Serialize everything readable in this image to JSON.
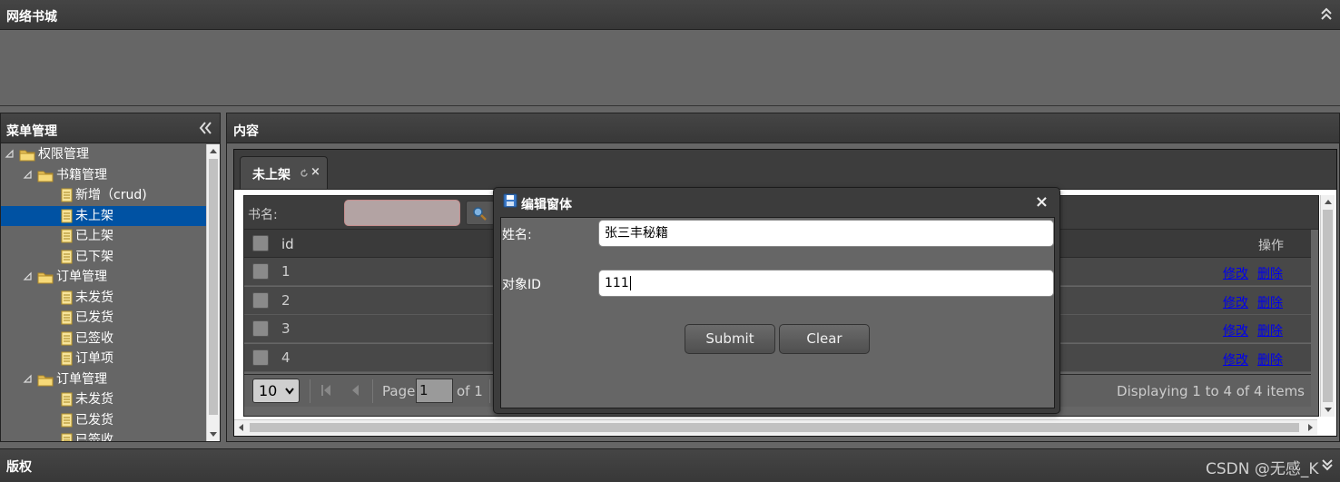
{
  "north": {
    "title": "网络书城"
  },
  "west": {
    "title": "菜单管理",
    "tree": [
      {
        "label": "权限管理",
        "type": "folder",
        "level": 0
      },
      {
        "label": "书籍管理",
        "type": "folder",
        "level": 1
      },
      {
        "label": "新增（crud)",
        "type": "file",
        "level": 2
      },
      {
        "label": "未上架",
        "type": "file",
        "level": 2,
        "selected": true
      },
      {
        "label": "已上架",
        "type": "file",
        "level": 2
      },
      {
        "label": "已下架",
        "type": "file",
        "level": 2
      },
      {
        "label": "订单管理",
        "type": "folder",
        "level": 1
      },
      {
        "label": "未发货",
        "type": "file",
        "level": 2
      },
      {
        "label": "已发货",
        "type": "file",
        "level": 2
      },
      {
        "label": "已签收",
        "type": "file",
        "level": 2
      },
      {
        "label": "订单项",
        "type": "file",
        "level": 2
      },
      {
        "label": "订单管理",
        "type": "folder",
        "level": 1
      },
      {
        "label": "未发货",
        "type": "file",
        "level": 2
      },
      {
        "label": "已发货",
        "type": "file",
        "level": 2
      },
      {
        "label": "已签收",
        "type": "file",
        "level": 2
      }
    ]
  },
  "center": {
    "title": "内容",
    "tab": {
      "label": "未上架",
      "close": "×"
    },
    "toolbar": {
      "search_label": "书名:"
    },
    "grid": {
      "columns": {
        "id": "id",
        "op": "操作"
      },
      "rows": [
        {
          "id": "1",
          "edit": "修改",
          "del": "删除"
        },
        {
          "id": "2",
          "edit": "修改",
          "del": "删除"
        },
        {
          "id": "3",
          "edit": "修改",
          "del": "删除"
        },
        {
          "id": "4",
          "edit": "修改",
          "del": "删除"
        }
      ]
    },
    "pager": {
      "page_size": "10",
      "page_label": "Page",
      "page_value": "1",
      "of_label": "of 1",
      "display": "Displaying 1 to 4 of 4 items"
    }
  },
  "dialog": {
    "title": "编辑窗体",
    "close": "×",
    "name_label": "姓名:",
    "name_value": "张三丰秘籍",
    "id_label": "对象ID",
    "id_value": "111",
    "submit": "Submit",
    "clear": "Clear"
  },
  "south": {
    "title": "版权",
    "watermark": "CSDN @无感_K"
  },
  "colors": {
    "selected": "#0052A3",
    "link": "#0000ee",
    "header": "#3d3d3d",
    "panel": "#666666"
  }
}
